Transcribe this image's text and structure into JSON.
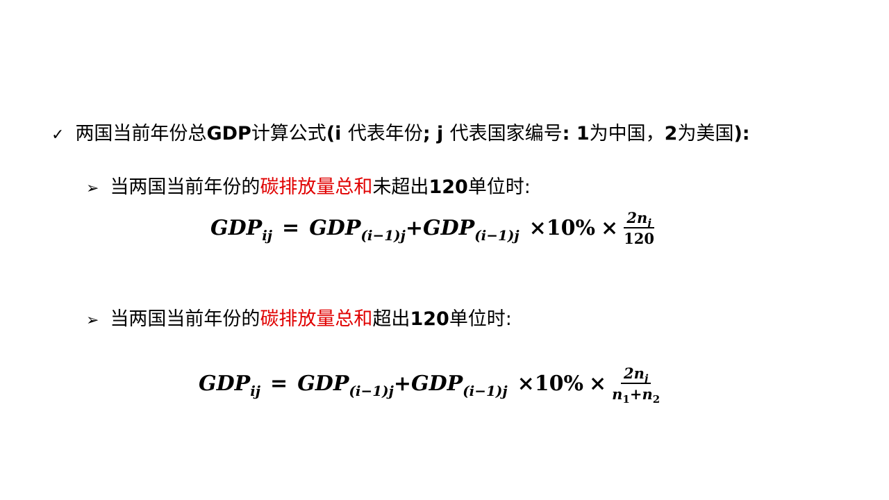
{
  "bullets": {
    "main": {
      "marker": "✓",
      "text_a": "两国当前年份总",
      "text_b": "GDP",
      "text_c": "计算公式",
      "text_d": "(i ",
      "text_e": "代表年份",
      "text_f": "; j ",
      "text_g": "代表国家编号",
      "text_h": ": 1",
      "text_i": "为中国，",
      "text_j": "2",
      "text_k": "为美国",
      "text_l": "):"
    },
    "cond1": {
      "marker": "➢",
      "text_a": "当两国当前年份的",
      "text_red": "碳排放量总和",
      "text_b": "未超出",
      "text_num": "120",
      "text_c": "单位时:"
    },
    "cond2": {
      "marker": "➢",
      "text_a": "当两国当前年份的",
      "text_red": "碳排放量总和",
      "text_b": "超出",
      "text_num": "120",
      "text_c": "单位时:"
    }
  },
  "formula1": {
    "lhs": "GDP",
    "lhs_sub": "ij",
    "eq": "=",
    "t1": "GDP",
    "t1_sub": "(i−1)j",
    "plus": "+",
    "t2": "GDP",
    "t2_sub": "(i−1)j",
    "times1": "×10%",
    "times2": "×",
    "num": "2n",
    "num_sub": "j",
    "den": "120"
  },
  "formula2": {
    "lhs": "GDP",
    "lhs_sub": "ij",
    "eq": "=",
    "t1": "GDP",
    "t1_sub": "(i−1)j",
    "plus": "+",
    "t2": "GDP",
    "t2_sub": "(i−1)j",
    "times1": "×10%",
    "times2": "×",
    "num": "2n",
    "num_sub": "j",
    "den_a": "n",
    "den_a_sub": "1",
    "den_plus": "+",
    "den_b": "n",
    "den_b_sub": "2"
  },
  "colors": {
    "highlight": "#e00000",
    "text": "#000000",
    "background": "#ffffff"
  }
}
